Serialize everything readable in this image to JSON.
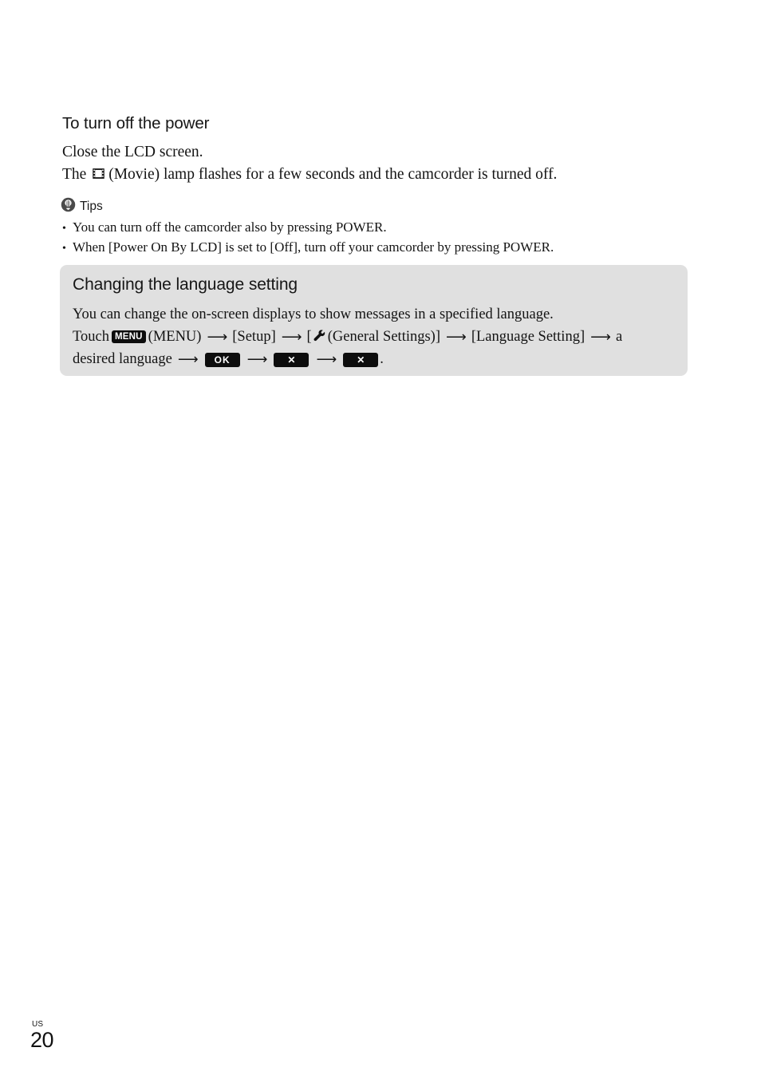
{
  "page": {
    "heading": "To turn off the power",
    "body_line_1": "Close the LCD screen.",
    "body_line_2_prefix": "The ",
    "body_line_2_suffix": "(Movie) lamp flashes for a few seconds and the camcorder is turned off."
  },
  "tips": {
    "label": "Tips",
    "icon": "tips-lightbulb-icon",
    "items": [
      "You can turn off the camcorder also by pressing POWER.",
      "When [Power On By LCD] is set to [Off], turn off your camcorder by pressing POWER."
    ],
    "bullet_glyph": "•"
  },
  "callout": {
    "title": "Changing the language setting",
    "line_1": "You can change the on-screen displays to show messages in a specified language.",
    "line_2": {
      "touch": "Touch",
      "menu_button": "MENU",
      "menu_paren": "(MENU)",
      "setup": "[Setup]",
      "general_open": "[",
      "general_settings": "(General Settings)]",
      "language_setting": "[Language Setting]",
      "a": "a"
    },
    "line_3": {
      "desired_language": "desired language",
      "ok_button": "OK",
      "close_button_1": "✕",
      "close_button_2": "✕",
      "period": "."
    },
    "background_color": "#e0e0e0"
  },
  "footer": {
    "region": "US",
    "page_number": "20"
  }
}
